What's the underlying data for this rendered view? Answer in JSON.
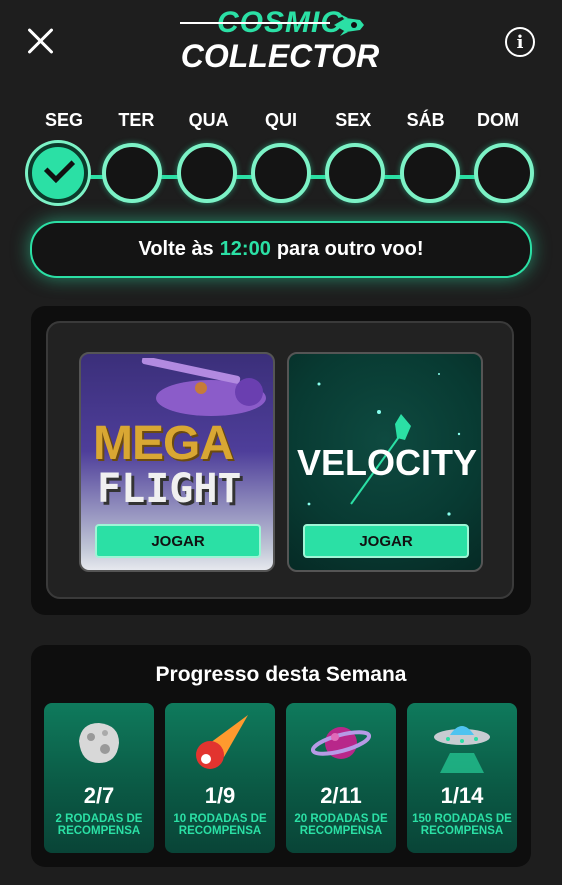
{
  "header": {
    "logo_line1": "COSMIC",
    "logo_line2": "COLLECTOR",
    "close_icon": "close-icon",
    "info_icon": "info-icon",
    "info_glyph": "i"
  },
  "week": {
    "days": [
      "SEG",
      "TER",
      "QUA",
      "QUI",
      "SEX",
      "SÁB",
      "DOM"
    ],
    "completed": [
      true,
      false,
      false,
      false,
      false,
      false,
      false
    ]
  },
  "banner": {
    "prefix": "Volte às",
    "time": "12:00",
    "suffix": "para outro voo!"
  },
  "games": [
    {
      "title_line1": "MEGA",
      "title_line2": "FLIGHT",
      "button": "JOGAR"
    },
    {
      "title_line1": "VELOCITY",
      "button": "JOGAR"
    }
  ],
  "progress": {
    "title": "Progresso desta Semana",
    "items": [
      {
        "icon": "asteroid-icon",
        "count": "2/7",
        "reward": "2 RODADAS DE RECOMPENSA"
      },
      {
        "icon": "comet-icon",
        "count": "1/9",
        "reward": "10 RODADAS DE RECOMPENSA"
      },
      {
        "icon": "planet-icon",
        "count": "2/11",
        "reward": "20 RODADAS DE RECOMPENSA"
      },
      {
        "icon": "ufo-icon",
        "count": "1/14",
        "reward": "150 RODADAS DE RECOMPENSA"
      }
    ]
  },
  "colors": {
    "accent": "#2be0a5",
    "background": "#1e1e1e",
    "panel": "#0e0e0e"
  }
}
